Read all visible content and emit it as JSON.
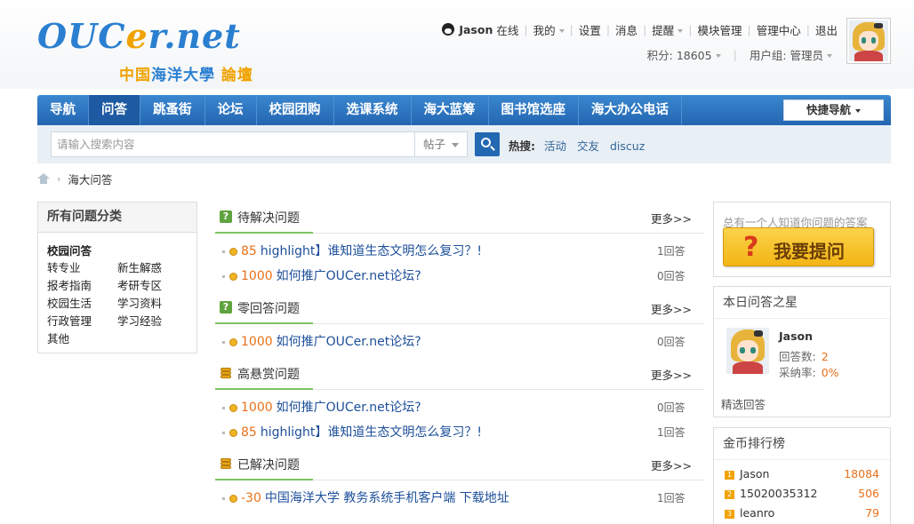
{
  "logo": {
    "brand_main": "OUC",
    "brand_e": "e",
    "brand_rest": "r.net",
    "sub_prefix": "中国",
    "sub_bold": "海洋大學",
    "sub_suffix": " 論壇"
  },
  "user_menu": {
    "username": "Jason",
    "status": "在线",
    "items": [
      "我的",
      "设置",
      "消息",
      "提醒",
      "模块管理",
      "管理中心",
      "退出"
    ],
    "points": "积分: 18605",
    "group": "用户组: 管理员"
  },
  "nav": {
    "items": [
      "导航",
      "问答",
      "跳蚤街",
      "论坛",
      "校园团购",
      "选课系统",
      "海大蓝筹",
      "图书馆选座",
      "海大办公电话"
    ],
    "active_index": 1,
    "quick_nav": "快捷导航"
  },
  "search": {
    "placeholder": "请输入搜索内容",
    "type": "帖子",
    "hot_label": "热搜:",
    "hot_keywords": [
      "活动",
      "交友",
      "discuz"
    ]
  },
  "breadcrumb": {
    "current": "海大问答"
  },
  "categories": {
    "title": "所有问题分类",
    "group": "校园问答",
    "items": [
      "转专业",
      "新生解惑",
      "报考指南",
      "考研专区",
      "校园生活",
      "学习资料",
      "行政管理",
      "学习经验",
      "其他"
    ]
  },
  "sections": [
    {
      "title": "待解决问题",
      "more": "更多>>",
      "icon": "question-icon",
      "items": [
        {
          "reward": "85",
          "title": "highlight】谁知道生态文明怎么复习？!",
          "answers": "1回答"
        },
        {
          "reward": "1000",
          "title": "如何推广OUCer.net论坛?",
          "answers": "0回答"
        }
      ]
    },
    {
      "title": "零回答问题",
      "more": "更多>>",
      "icon": "question-icon",
      "items": [
        {
          "reward": "1000",
          "title": "如何推广OUCer.net论坛?",
          "answers": "0回答"
        }
      ]
    },
    {
      "title": "高悬赏问题",
      "more": "更多>>",
      "icon": "coins-icon",
      "items": [
        {
          "reward": "1000",
          "title": "如何推广OUCer.net论坛?",
          "answers": "0回答"
        },
        {
          "reward": "85",
          "title": "highlight】谁知道生态文明怎么复习？!",
          "answers": "1回答"
        }
      ]
    },
    {
      "title": "已解决问题",
      "more": "更多>>",
      "icon": "coins-icon",
      "items": [
        {
          "reward": "-30",
          "title": "中国海洋大学 教务系统手机客户端 下载地址",
          "answers": "1回答"
        }
      ]
    }
  ],
  "ask": {
    "hint": "总有一个人知道你问题的答案",
    "button": "我要提问",
    "button_mark": "?"
  },
  "star": {
    "title": "本日问答之星",
    "name": "Jason",
    "answers_label": "回答数:",
    "answers_value": "2",
    "rate_label": "采纳率:",
    "rate_value": "0%",
    "pick": "精选回答"
  },
  "rank": {
    "title": "金币排行榜",
    "rows": [
      {
        "num": "1",
        "name": "Jason",
        "value": "18084"
      },
      {
        "num": "2",
        "name": "15020035312",
        "value": "506"
      },
      {
        "num": "3",
        "name": "leanro",
        "value": "79"
      }
    ]
  }
}
